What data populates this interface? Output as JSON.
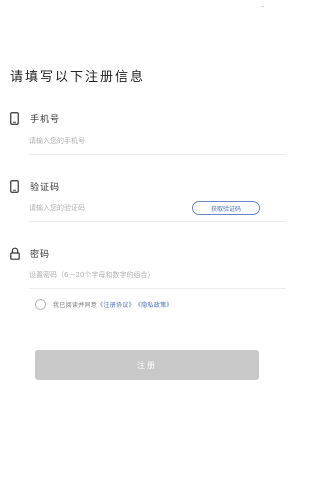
{
  "page": {
    "title": "请填写以下注册信息"
  },
  "form": {
    "phone": {
      "icon": "phone-icon",
      "label": "手机号",
      "placeholder": "请输入您的手机号",
      "value": ""
    },
    "code": {
      "icon": "phone-icon",
      "label": "验证码",
      "placeholder": "请输入您的验证码",
      "value": "",
      "button_label": "获取验证码"
    },
    "password": {
      "icon": "lock-icon",
      "label": "密码",
      "placeholder": "设置密码（6－20个字母和数字的组合）",
      "value": ""
    }
  },
  "agreement": {
    "checked": false,
    "prefix": "我已阅读并同意",
    "terms_link": "《注册协议》",
    "privacy_link": "《隐私政策》"
  },
  "submit": {
    "label": "注册"
  },
  "colors": {
    "accent": "#4d6fbf",
    "button_disabled": "#c8c8c8",
    "divider": "#ececec"
  }
}
